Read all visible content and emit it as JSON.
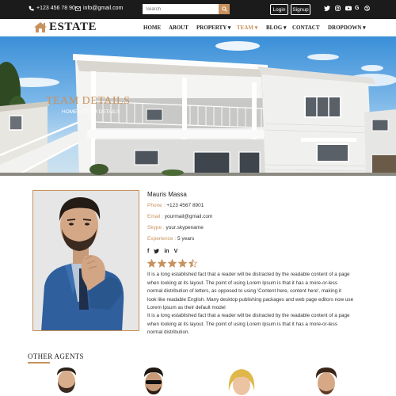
{
  "topbar": {
    "phone": "+123 456 78 90",
    "email": "info@gmail.com",
    "search_placeholder": "Search",
    "login_label": "Login",
    "signup_label": "Signup"
  },
  "nav": {
    "logo_text": "ESTATE",
    "items": [
      {
        "label": "HOME"
      },
      {
        "label": "ABOUT"
      },
      {
        "label": "PROPERTY ▾"
      },
      {
        "label": "TEAM ▾"
      },
      {
        "label": "BLOG ▾"
      },
      {
        "label": "CONTACT"
      },
      {
        "label": "DROPDOWN ▾"
      }
    ]
  },
  "hero": {
    "title": "TEAM DETAILS",
    "breadcrumb": "HOME > TEAM DETAILS"
  },
  "agent": {
    "name": "Mauris Massa",
    "phone_label": "Phone :",
    "phone": "+123 4567 8901",
    "email_label": "Email :",
    "email": "yourmail@gmail.com",
    "skype_label": "Skype :",
    "skype": "your.skypename",
    "experience_label": "Experience :",
    "experience": "5 years",
    "rating": 4.5,
    "bio1_lines": [
      "It is a long established fact that a reader will be distracted by the readable content of a page",
      "when looking at its layout. The point of using Lorem Ipsum is that it has a more-or-less",
      "normal distribution of letters, as opposed to using 'Content here, content here', making it",
      "look like readable English. Many desktop publishing packages and web page editors now use",
      "Lorem Ipsum as their default model"
    ],
    "bio2_lines": [
      "It is a long established fact that a reader will be distracted by the readable content of a page",
      "when looking at its layout. The point of using Lorem Ipsum is that it has a more-or-less",
      "normal distribution."
    ]
  },
  "other_agents": {
    "title": "OTHER AGENTS"
  },
  "colors": {
    "accent": "#c8925e",
    "topbar": "#1b1b1b"
  }
}
